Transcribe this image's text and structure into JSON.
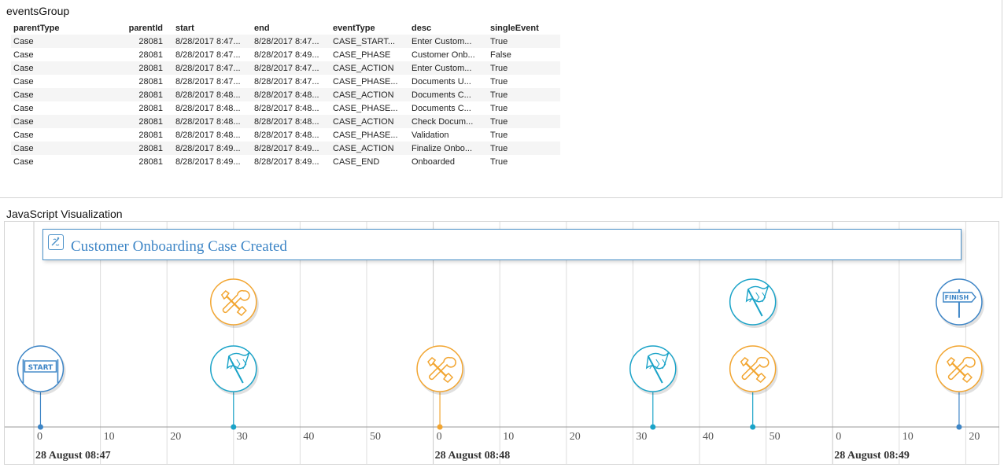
{
  "top_panel": {
    "title": "eventsGroup",
    "columns": [
      "parentType",
      "parentId",
      "start",
      "end",
      "eventType",
      "desc",
      "singleEvent"
    ],
    "rows": [
      [
        "Case",
        "28081",
        "8/28/2017 8:47...",
        "8/28/2017 8:47...",
        "CASE_START...",
        "Enter Custom...",
        "True"
      ],
      [
        "Case",
        "28081",
        "8/28/2017 8:47...",
        "8/28/2017 8:49...",
        "CASE_PHASE",
        "Customer Onb...",
        "False"
      ],
      [
        "Case",
        "28081",
        "8/28/2017 8:47...",
        "8/28/2017 8:47...",
        "CASE_ACTION",
        "Enter Custom...",
        "True"
      ],
      [
        "Case",
        "28081",
        "8/28/2017 8:47...",
        "8/28/2017 8:47...",
        "CASE_PHASE...",
        "Documents U...",
        "True"
      ],
      [
        "Case",
        "28081",
        "8/28/2017 8:48...",
        "8/28/2017 8:48...",
        "CASE_ACTION",
        "Documents C...",
        "True"
      ],
      [
        "Case",
        "28081",
        "8/28/2017 8:48...",
        "8/28/2017 8:48...",
        "CASE_PHASE...",
        "Documents C...",
        "True"
      ],
      [
        "Case",
        "28081",
        "8/28/2017 8:48...",
        "8/28/2017 8:48...",
        "CASE_ACTION",
        "Check Docum...",
        "True"
      ],
      [
        "Case",
        "28081",
        "8/28/2017 8:48...",
        "8/28/2017 8:48...",
        "CASE_PHASE...",
        "Validation",
        "True"
      ],
      [
        "Case",
        "28081",
        "8/28/2017 8:49...",
        "8/28/2017 8:49...",
        "CASE_ACTION",
        "Finalize Onbo...",
        "True"
      ],
      [
        "Case",
        "28081",
        "8/28/2017 8:49...",
        "8/28/2017 8:49...",
        "CASE_END",
        "Onboarded",
        "True"
      ]
    ]
  },
  "viz_panel": {
    "title": "JavaScript Visualization",
    "banner_text": "Customer Onboarding Case Created",
    "colors": {
      "phase": "#1aa3c8",
      "action": "#f2a530",
      "marker_blue": "#3d85c6",
      "grid": "#dddddd"
    },
    "axis": {
      "minutes": [
        {
          "label": "28 August 08:47",
          "ticks": [
            "0",
            "10",
            "20",
            "30",
            "40",
            "50"
          ]
        },
        {
          "label": "28 August 08:48",
          "ticks": [
            "0",
            "10",
            "20",
            "30",
            "40",
            "50"
          ]
        },
        {
          "label": "28 August 08:49",
          "ticks": [
            "0",
            "10",
            "20"
          ]
        }
      ]
    },
    "events": [
      {
        "minute": 0,
        "second": 1,
        "icon": "start-banner-icon",
        "kind": "start",
        "row": "low",
        "marker_color": "#3d85c6",
        "start_text": "START"
      },
      {
        "minute": 0,
        "second": 30,
        "icon": "wrench-icon",
        "kind": "action",
        "row": "high",
        "marker_color": "#1aa3c8"
      },
      {
        "minute": 0,
        "second": 30,
        "icon": "checkered-flag-icon",
        "kind": "phase",
        "row": "low",
        "marker_color": "#1aa3c8"
      },
      {
        "minute": 1,
        "second": 1,
        "icon": "wrench-icon",
        "kind": "action",
        "row": "low",
        "marker_color": "#f2a530"
      },
      {
        "minute": 1,
        "second": 33,
        "icon": "checkered-flag-icon",
        "kind": "phase",
        "row": "low",
        "marker_color": "#1aa3c8"
      },
      {
        "minute": 1,
        "second": 48,
        "icon": "checkered-flag-icon",
        "kind": "phase",
        "row": "high",
        "marker_color": "#1aa3c8"
      },
      {
        "minute": 1,
        "second": 48,
        "icon": "wrench-icon",
        "kind": "action",
        "row": "low",
        "marker_color": "#1aa3c8"
      },
      {
        "minute": 2,
        "second": 19,
        "icon": "finish-signpost-icon",
        "kind": "finish",
        "row": "high",
        "marker_color": "#3d85c6",
        "finish_text": "FINISH"
      },
      {
        "minute": 2,
        "second": 19,
        "icon": "wrench-icon",
        "kind": "action",
        "row": "low",
        "marker_color": "#3d85c6"
      }
    ]
  }
}
